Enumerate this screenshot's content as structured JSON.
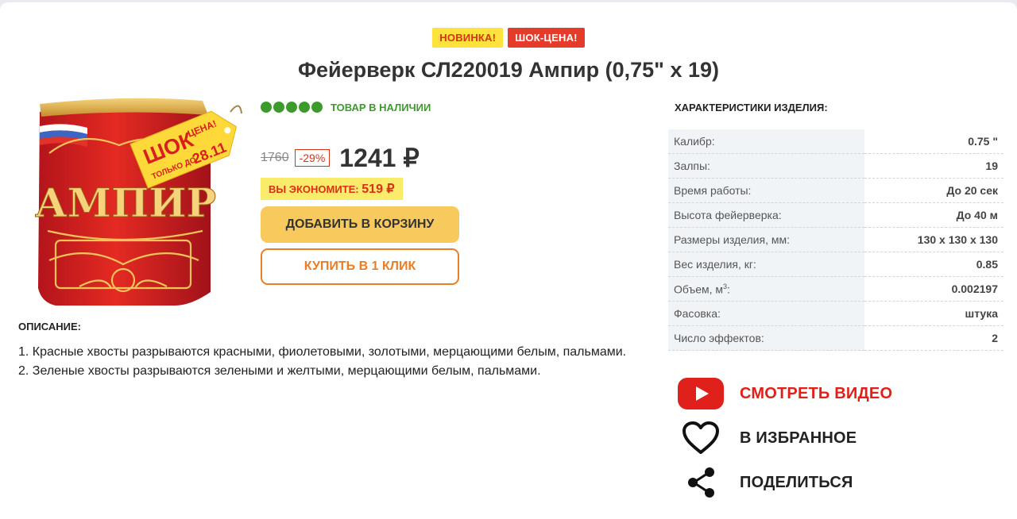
{
  "badges": {
    "new": "НОВИНКА!",
    "shock": "ШОК-ЦЕНА!"
  },
  "product": {
    "title": "Фейерверк СЛ220019 Ампир (0,75\" x 19)",
    "image_text": {
      "brand": "АМПИР",
      "tag_line1": "ШОК",
      "tag_line2": "ЦЕНА!",
      "tag_line3": "ТОЛЬКО ДО",
      "tag_date": "28.11"
    }
  },
  "stock": {
    "text": "ТОВАР В НАЛИЧИИ",
    "level": 5,
    "level_max": 5
  },
  "price": {
    "old": "1760",
    "discount": "-29%",
    "current": "1241 ₽",
    "saving_label": "ВЫ ЭКОНОМИТЕ:",
    "saving_amount": "519 ₽"
  },
  "buttons": {
    "add_to_cart": "ДОБАВИТЬ В КОРЗИНУ",
    "buy_one_click": "КУПИТЬ В 1 КЛИК"
  },
  "description": {
    "heading": "ОПИСАНИЕ:",
    "items": [
      "1. Красные хвосты разрываются красными, фиолетовыми, золотыми, мерцающими белым, пальмами.",
      "2. Зеленые хвосты разрываются зелеными и желтыми, мерцающими белым, пальмами."
    ]
  },
  "specs": {
    "heading": "ХАРАКТЕРИСТИКИ ИЗДЕЛИЯ:",
    "rows": [
      {
        "label": "Калибр:",
        "value": "0.75 \""
      },
      {
        "label": "Залпы:",
        "value": "19"
      },
      {
        "label": "Время работы:",
        "value": "До 20 сек"
      },
      {
        "label": "Высота фейерверка:",
        "value": "До 40 м"
      },
      {
        "label": "Размеры изделия, мм:",
        "value": "130 x 130 x 130"
      },
      {
        "label": "Вес изделия, кг:",
        "value": "0.85"
      },
      {
        "label": "Объем, м",
        "sup": "3",
        "label_suffix": ":",
        "value": "0.002197"
      },
      {
        "label": "Фасовка:",
        "value": "штука"
      },
      {
        "label": "Число эффектов:",
        "value": "2"
      }
    ]
  },
  "actions": {
    "video": {
      "label": "СМОТРЕТЬ ВИДЕО",
      "icon": "youtube-play-icon"
    },
    "favorite": {
      "label": "В ИЗБРАННОЕ",
      "icon": "heart-icon"
    },
    "share": {
      "label": "ПОДЕЛИТЬСЯ",
      "icon": "share-icon"
    }
  },
  "colors": {
    "accent_green": "#3d9a2c",
    "accent_red": "#e0201b",
    "cart_button": "#f8c95c",
    "one_click_border": "#ea7d25",
    "saving_bg": "#fbeb6b",
    "badge_new_bg": "#ffe23b",
    "badge_shock_bg": "#e53b2a"
  }
}
